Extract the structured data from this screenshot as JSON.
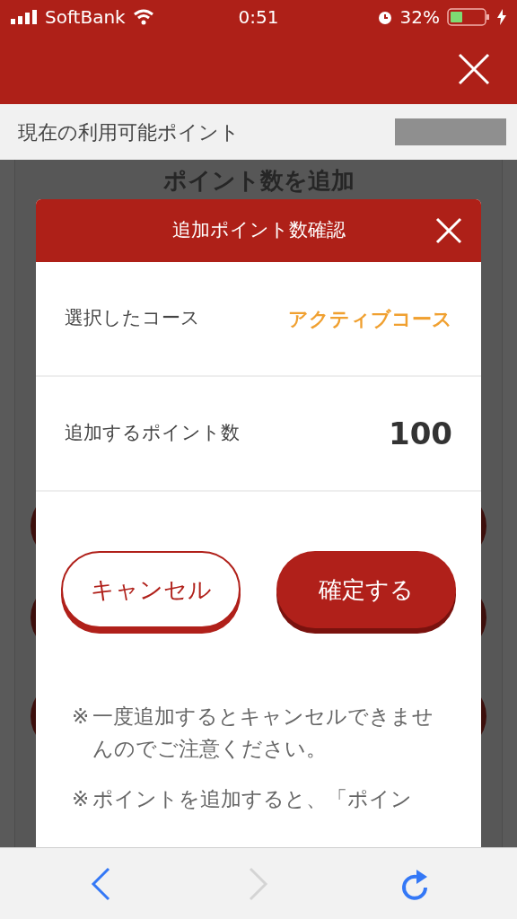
{
  "status_bar": {
    "carrier": "SoftBank",
    "time": "0:51",
    "battery": "32%"
  },
  "points_bar": {
    "label": "現在の利用可能ポイント"
  },
  "background": {
    "heading": "ポイント数を追加"
  },
  "dialog": {
    "title": "追加ポイント数確認",
    "rows": [
      {
        "label": "選択したコース",
        "value": "アクティブコース",
        "kind": "accent"
      },
      {
        "label": "追加するポイント数",
        "value": "100",
        "kind": "number"
      }
    ],
    "buttons": [
      {
        "label": "キャンセル",
        "kind": "secondary"
      },
      {
        "label": "確定する",
        "kind": "primary"
      }
    ],
    "notes": [
      {
        "mark": "※",
        "text": "一度追加するとキャンセルできませんのでご注意ください。"
      },
      {
        "mark": "※",
        "text": "ポイントを追加すると、「ポイン"
      }
    ]
  },
  "toolbar": [
    {
      "kind": "back",
      "disabled": false
    },
    {
      "kind": "forward",
      "disabled": true
    },
    {
      "kind": "reload",
      "disabled": false
    }
  ]
}
